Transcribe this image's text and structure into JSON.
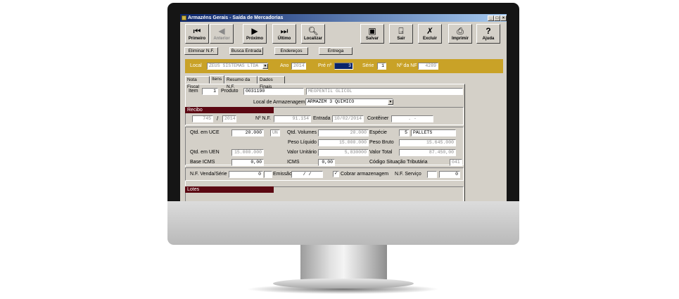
{
  "window": {
    "title": "Armazéns Gerais - Saída de Mercadorias"
  },
  "toolbar": {
    "primeiro": "Primeiro",
    "anterior": "Anterior",
    "proximo": "Próximo",
    "ultimo": "Último",
    "localizar": "Localizar",
    "salvar": "Salvar",
    "sair": "Sair",
    "excluir": "Excluir",
    "imprimir": "Imprimir",
    "ajuda": "Ajuda"
  },
  "subbar": {
    "eliminar": "Eliminar N.F.",
    "busca": "Busca Entrada",
    "enderecos": "Endereços",
    "entrega": "Entrega"
  },
  "header": {
    "local_label": "Local",
    "local_value": "ZEUS SISTEMAS LTDA",
    "ano_label": "Ano",
    "ano_value": "2014",
    "pre_label": "Pré nº",
    "pre_value": "3",
    "serie_label": "Série",
    "serie_value": "1",
    "nf_label": "Nº da NF",
    "nf_value": "4289"
  },
  "tabs": [
    "Nota Fiscal",
    "Itens",
    "Resumo da N.F.",
    "Dados Finais"
  ],
  "item": {
    "item_label": "Item",
    "item_value": "1",
    "produto_label": "Produto",
    "produto_code": "0031190",
    "produto_desc": "MEOPENTIL GLICOL",
    "local_label": "Local de Armazenagem",
    "local_value": "ARMAZEM 3 QUIMICO"
  },
  "recibo": {
    "title": "Recibo",
    "num": "745",
    "sep": "/",
    "year": "2014",
    "nf_label": "Nº N.F.",
    "nf_value": "91.154",
    "entrada_label": "Entrada",
    "entrada_value": "10/02/2014",
    "conteiner_label": "Contêiner",
    "conteiner_value": ". -"
  },
  "quantities": {
    "qtd_uce_label": "Qtd. em UCE",
    "qtd_uce_value": "20.000",
    "uce_unit": "UN",
    "qtd_vol_label": "Qtd. Volumes",
    "qtd_vol_value": "20.000",
    "especie_label": "Espécie",
    "especie_code": "5",
    "especie_value": "PALLETS",
    "peso_liq_label": "Peso Líquido",
    "peso_liq_value": "15.000.000",
    "peso_bruto_label": "Peso Bruto",
    "peso_bruto_value": "15.645.000",
    "qtd_uen_label": "Qtd. em UEN",
    "qtd_uen_value": "15.000.000",
    "valor_unit_label": "Valor Unitário",
    "valor_unit_value": "5,830000",
    "valor_total_label": "Valor Total",
    "valor_total_value": "87.450,00",
    "base_icms_label": "Base ICMS",
    "base_icms_value": "0,00",
    "icms_label": "ICMS",
    "icms_value": "0,00",
    "cst_label": "Código Situação Tributária",
    "cst_value": "041"
  },
  "venda": {
    "nf_venda_label": "N.F. Venda/Série",
    "nf_venda_value": "0",
    "emissao_label": "Emissão",
    "emissao_value": "/ /",
    "cobrar_label": "Cobrar armazenagem",
    "cobrar_checked": true,
    "nf_servico_label": "N.F. Serviço",
    "nf_servico_value": "0"
  },
  "lotes": {
    "title": "Lotes"
  }
}
